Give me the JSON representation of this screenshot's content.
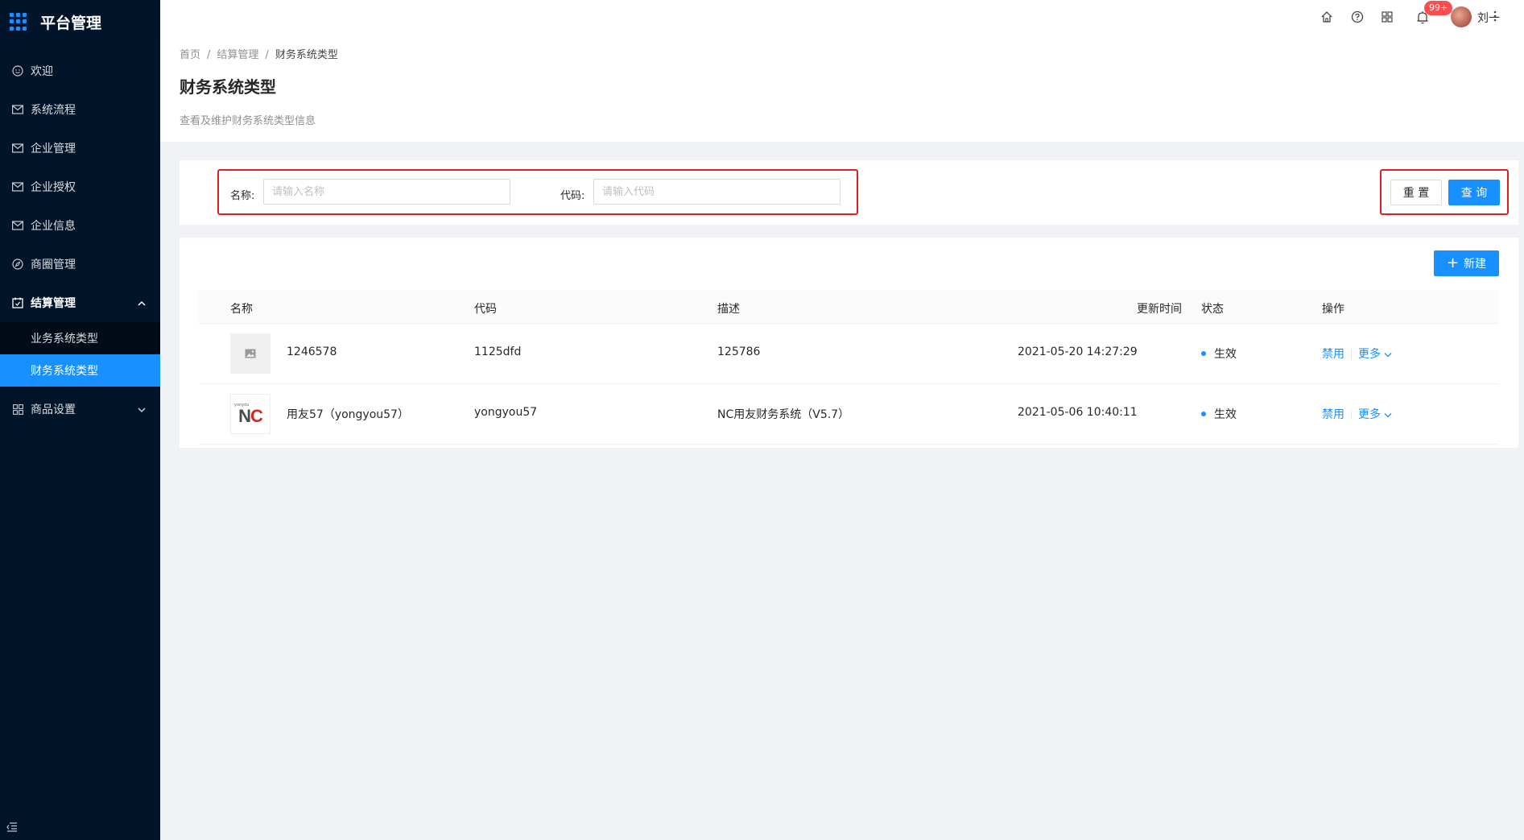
{
  "app": {
    "title": "平台管理"
  },
  "sidebar": {
    "items": [
      {
        "label": "欢迎",
        "icon": "smile-icon"
      },
      {
        "label": "系统流程",
        "icon": "mail-icon"
      },
      {
        "label": "企业管理",
        "icon": "mail-icon"
      },
      {
        "label": "企业授权",
        "icon": "mail-icon"
      },
      {
        "label": "企业信息",
        "icon": "mail-icon"
      },
      {
        "label": "商圈管理",
        "icon": "compass-icon"
      },
      {
        "label": "结算管理",
        "icon": "calendar-icon",
        "expanded": true,
        "children": [
          {
            "label": "业务系统类型",
            "active": false
          },
          {
            "label": "财务系统类型",
            "active": true
          }
        ]
      },
      {
        "label": "商品设置",
        "icon": "appstore-icon",
        "expanded": false
      }
    ]
  },
  "header": {
    "notification_badge": "99+",
    "user_name": "刘一",
    "icons": [
      "home-icon",
      "question-icon",
      "appstore-icon",
      "bell-icon"
    ]
  },
  "page": {
    "breadcrumb": [
      "首页",
      "结算管理",
      "财务系统类型"
    ],
    "title": "财务系统类型",
    "description": "查看及维护财务系统类型信息"
  },
  "search": {
    "name_label": "名称:",
    "name_placeholder": "请输入名称",
    "code_label": "代码:",
    "code_placeholder": "请输入代码",
    "reset_label": "重 置",
    "query_label": "查 询"
  },
  "table": {
    "new_label": "新建",
    "columns": [
      "名称",
      "代码",
      "描述",
      "更新时间",
      "状态",
      "操作"
    ],
    "rows": [
      {
        "name": "1246578",
        "code": "1125dfd",
        "desc": "125786",
        "updated": "2021-05-20 14:27:29",
        "status": "生效",
        "action_disable": "禁用",
        "action_more": "更多",
        "thumb": "image-placeholder-icon"
      },
      {
        "name": "用友57（yongyou57）",
        "code": "yongyou57",
        "desc": "NC用友财务系统（V5.7）",
        "updated": "2021-05-06 10:40:11",
        "status": "生效",
        "action_disable": "禁用",
        "action_more": "更多",
        "thumb": "nc-logo",
        "logo_text_small": "yonyou",
        "logo_text": "NC"
      }
    ]
  },
  "colors": {
    "primary": "#1890ff",
    "sidebar_bg": "#001529",
    "highlight_border": "#e02020",
    "badge": "#ff4d4f"
  }
}
